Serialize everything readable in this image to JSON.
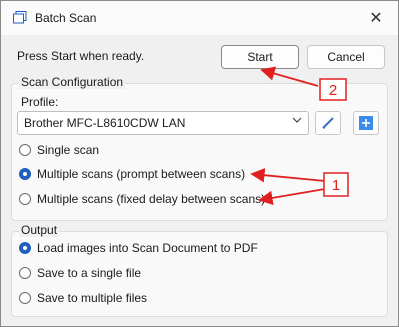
{
  "window": {
    "title": "Batch Scan",
    "close_glyph": "✕"
  },
  "header": {
    "ready_text": "Press Start when ready.",
    "start_label": "Start",
    "cancel_label": "Cancel"
  },
  "scan_config": {
    "group_label": "Scan Configuration",
    "profile_label": "Profile:",
    "profile_value": "Brother MFC-L8610CDW LAN",
    "options": [
      {
        "label": "Single scan",
        "selected": false
      },
      {
        "label": "Multiple scans (prompt between scans)",
        "selected": true
      },
      {
        "label": "Multiple scans (fixed delay between scans)",
        "selected": false
      }
    ]
  },
  "output": {
    "group_label": "Output",
    "options": [
      {
        "label": "Load images into Scan Document to PDF",
        "selected": true
      },
      {
        "label": "Save to a single file",
        "selected": false
      },
      {
        "label": "Save to multiple files",
        "selected": false
      }
    ]
  },
  "annotations": {
    "callout_1": "1",
    "callout_2": "2",
    "accent_color": "#e02020"
  },
  "icons": [
    "batch-scan-app-icon",
    "close-icon",
    "chevron-down-icon",
    "pencil-edit-icon",
    "add-plus-icon"
  ],
  "colors": {
    "radio_selected": "#1f5fbf",
    "add_button": "#3b8bea"
  }
}
